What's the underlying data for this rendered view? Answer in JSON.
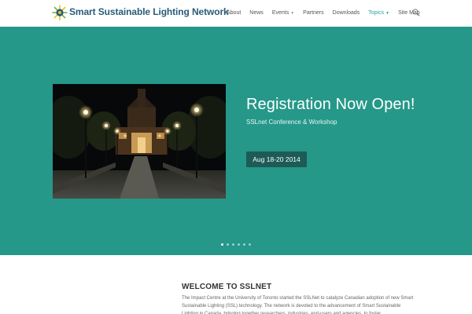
{
  "header": {
    "site_title": "Smart Sustainable Lighting Network",
    "logo_icon": "sslnet-logo-icon",
    "nav": [
      {
        "label": "About",
        "active": false,
        "has_dropdown": false
      },
      {
        "label": "News",
        "active": false,
        "has_dropdown": false
      },
      {
        "label": "Events",
        "active": false,
        "has_dropdown": true
      },
      {
        "label": "Partners",
        "active": false,
        "has_dropdown": false
      },
      {
        "label": "Downloads",
        "active": false,
        "has_dropdown": false
      },
      {
        "label": "Topics",
        "active": true,
        "has_dropdown": true
      },
      {
        "label": "Site Map",
        "active": false,
        "has_dropdown": false
      }
    ],
    "search_icon": "search-icon"
  },
  "hero": {
    "title": "Registration Now Open!",
    "subtitle": "SSLnet Conference & Workshop",
    "button_label": "Aug 18-20 2014",
    "slide_count": 6,
    "active_slide": 1
  },
  "welcome": {
    "heading": "WELCOME TO SSLNET",
    "text": "The Impact Centre at the University of Toronto started the SSLNet to catalyze Canadian adoption of new Smart Sustainable Lighting (SSL) technology. The network is devoted to the advancement of Smart Sustainable Lighting in Canada, bringing together researchers, industries, end-users and agencies, to foster"
  },
  "colors": {
    "hero_bg": "#259889",
    "button_bg": "#1d5b56",
    "active_nav": "#2ea3a3",
    "title_color": "#2a5a7a"
  }
}
